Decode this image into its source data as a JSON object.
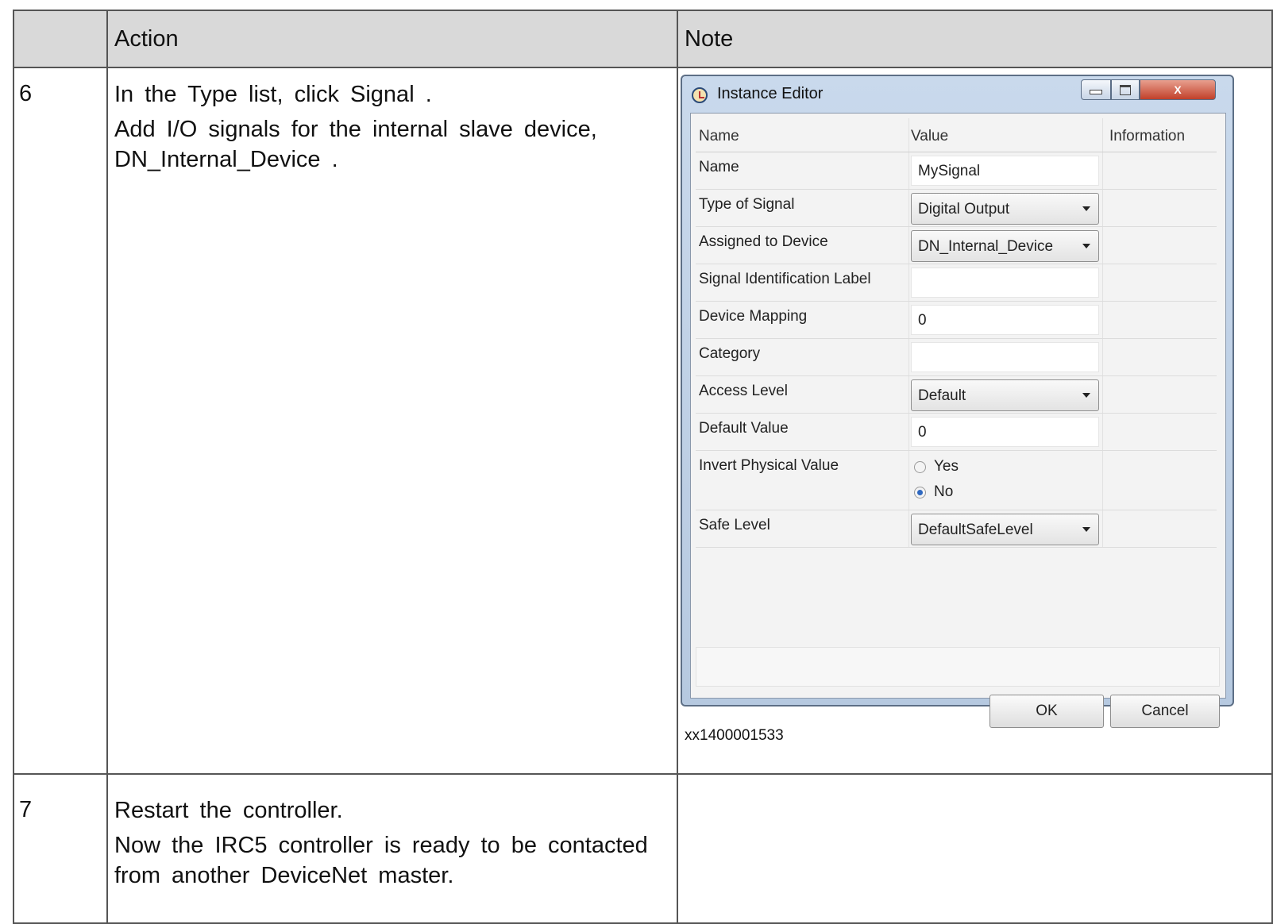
{
  "table": {
    "header": {
      "step": "",
      "action": "Action",
      "note": "Note"
    },
    "rows": [
      {
        "step": "6",
        "action": [
          "In the Type list, click Signal .",
          "Add I/O signals for the internal slave device, DN_Internal_Device ."
        ],
        "caption": "xx1400001533"
      },
      {
        "step": "7",
        "action": [
          "Restart the controller.",
          "Now the IRC5 controller is ready to be contacted from another DeviceNet master."
        ]
      }
    ]
  },
  "dialog": {
    "title": "Instance Editor",
    "close_glyph": "X",
    "columns": {
      "name": "Name",
      "value": "Value",
      "information": "Information"
    },
    "rows": [
      {
        "name": "Name",
        "value": "MySignal"
      },
      {
        "name": "Type of Signal",
        "value": "Digital Output"
      },
      {
        "name": "Assigned to Device",
        "value": "DN_Internal_Device"
      },
      {
        "name": "Signal Identification Label",
        "value": ""
      },
      {
        "name": "Device Mapping",
        "value": "0"
      },
      {
        "name": "Category",
        "value": ""
      },
      {
        "name": "Access Level",
        "value": "Default"
      },
      {
        "name": "Default Value",
        "value": "0"
      },
      {
        "name": "Invert Physical Value",
        "options": [
          "Yes",
          "No"
        ],
        "selected": "No"
      },
      {
        "name": "Safe Level",
        "value": "DefaultSafeLevel"
      }
    ],
    "buttons": {
      "ok": "OK",
      "cancel": "Cancel"
    }
  }
}
